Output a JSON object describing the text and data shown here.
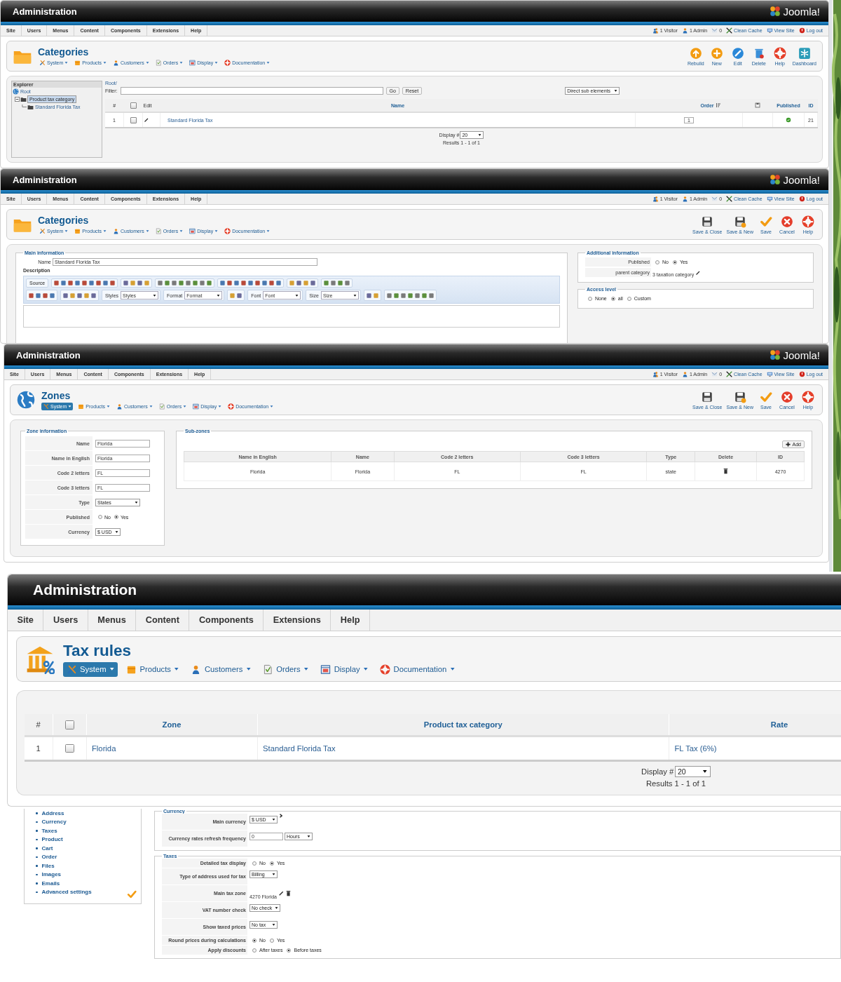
{
  "screens": [
    {
      "kind": "category_list",
      "header": {
        "title": "Administration",
        "logo": "Joomla!"
      },
      "menu": [
        "Site",
        "Users",
        "Menus",
        "Content",
        "Components",
        "Extensions",
        "Help"
      ],
      "status": [
        {
          "kind": "visitor",
          "label": "1 Visitor"
        },
        {
          "kind": "admin",
          "label": "1 Admin"
        },
        {
          "kind": "messages",
          "label": "0"
        },
        {
          "kind": "cache",
          "label": "Clean Cache"
        },
        {
          "kind": "site",
          "label": "View Site"
        },
        {
          "kind": "logout",
          "label": "Log out"
        }
      ],
      "page": {
        "kind": "folder",
        "title": "Categories"
      },
      "submenu": [
        {
          "kind": "system",
          "label": "System",
          "selected": false
        },
        {
          "kind": "products",
          "label": "Products",
          "selected": false
        },
        {
          "kind": "customers",
          "label": "Customers",
          "selected": false
        },
        {
          "kind": "orders",
          "label": "Orders",
          "selected": false
        },
        {
          "kind": "display",
          "label": "Display",
          "selected": false
        },
        {
          "kind": "documentation",
          "label": "Documentation",
          "selected": false
        }
      ],
      "toolbar": [
        {
          "kind": "rebuild",
          "label": "Rebuild"
        },
        {
          "kind": "new",
          "label": "New"
        },
        {
          "kind": "edit",
          "label": "Edit"
        },
        {
          "kind": "delete",
          "label": "Delete"
        },
        {
          "kind": "help",
          "label": "Help"
        },
        {
          "kind": "dashboard",
          "label": "Dashboard"
        }
      ],
      "explorer": {
        "title": "Explorer",
        "tree": [
          {
            "label": "Root",
            "selected": false,
            "children": [
              {
                "label": "Product tax category",
                "selected": true,
                "children": [
                  {
                    "label": "Standard Florida Tax",
                    "selected": false
                  }
                ]
              }
            ]
          }
        ]
      },
      "breadcrumb": "Root/",
      "filter": {
        "label": "Filter:"
      },
      "buttons": [
        "Go",
        "Reset"
      ],
      "view": "Direct sub elements",
      "columns": [
        {
          "kind": "text",
          "label": "#"
        },
        {
          "kind": "checkbox",
          "checked": false
        },
        {
          "kind": "text",
          "label": "Edit"
        },
        {
          "kind": "text",
          "label": "Name"
        },
        {
          "kind": "sort",
          "label": "Order"
        },
        {
          "kind": "icon"
        },
        {
          "kind": "text",
          "label": "Published"
        },
        {
          "kind": "text",
          "label": "ID"
        }
      ],
      "rows": [
        {
          "num": "1",
          "checked": false,
          "name": "Standard Florida Tax",
          "order": "1",
          "published": true,
          "id": "21"
        }
      ],
      "pagination": {
        "label": "Display #",
        "value": "20",
        "results": "Results 1 - 1 of 1"
      }
    },
    {
      "kind": "category_edit",
      "header": {
        "title": "Administration",
        "logo": "Joomla!"
      },
      "menu": [
        "Site",
        "Users",
        "Menus",
        "Content",
        "Components",
        "Extensions",
        "Help"
      ],
      "status": [
        {
          "kind": "visitor",
          "label": "1 Visitor"
        },
        {
          "kind": "admin",
          "label": "1 Admin"
        },
        {
          "kind": "messages",
          "label": "0"
        },
        {
          "kind": "cache",
          "label": "Clean Cache"
        },
        {
          "kind": "site",
          "label": "View Site"
        },
        {
          "kind": "logout",
          "label": "Log out"
        }
      ],
      "page": {
        "kind": "folder",
        "title": "Categories"
      },
      "submenu": [
        {
          "kind": "system",
          "label": "System",
          "selected": false
        },
        {
          "kind": "products",
          "label": "Products",
          "selected": false
        },
        {
          "kind": "customers",
          "label": "Customers",
          "selected": false
        },
        {
          "kind": "orders",
          "label": "Orders",
          "selected": false
        },
        {
          "kind": "display",
          "label": "Display",
          "selected": false
        },
        {
          "kind": "documentation",
          "label": "Documentation",
          "selected": false
        }
      ],
      "toolbar": [
        {
          "kind": "save_close",
          "label": "Save & Close"
        },
        {
          "kind": "save_new",
          "label": "Save & New"
        },
        {
          "kind": "save",
          "label": "Save"
        },
        {
          "kind": "cancel",
          "label": "Cancel"
        },
        {
          "kind": "help",
          "label": "Help"
        }
      ],
      "main": {
        "legend": "Main information",
        "name_label": "Name",
        "name_value": "Standard Florida Tax",
        "description_label": "Description",
        "editor": [
          [
            {
              "kind": "source",
              "label": "Source"
            },
            {
              "kind": "icons"
            },
            {
              "kind": "icons"
            },
            {
              "kind": "icons"
            },
            {
              "kind": "icons"
            },
            {
              "kind": "icons"
            },
            {
              "kind": "icons"
            }
          ],
          [
            {
              "kind": "icons"
            },
            {
              "kind": "icons"
            },
            {
              "kind": "combo",
              "label": "Styles",
              "value": "Styles"
            },
            {
              "kind": "combo",
              "label": "Format",
              "value": "Format"
            },
            {
              "kind": "icons"
            },
            {
              "kind": "combo",
              "label": "Font",
              "value": "Font"
            },
            {
              "kind": "combo",
              "label": "Size",
              "value": "Size"
            },
            {
              "kind": "icons"
            },
            {
              "kind": "icons"
            }
          ]
        ]
      },
      "additional": {
        "legend": "Additional information",
        "fields": [
          {
            "kind": "radio",
            "label": "Published",
            "options": [
              {
                "label": "No",
                "selected": false
              },
              {
                "label": "Yes",
                "selected": true
              }
            ]
          },
          {
            "kind": "link",
            "label": "parent category",
            "value": "3 taxation category"
          }
        ]
      },
      "access": {
        "legend": "Access level",
        "options": [
          {
            "label": "None",
            "selected": false
          },
          {
            "label": "all",
            "selected": true
          },
          {
            "label": "Custom",
            "selected": false
          }
        ]
      }
    },
    {
      "kind": "zone_edit",
      "header": {
        "title": "Administration",
        "logo": "Joomla!"
      },
      "menu": [
        "Site",
        "Users",
        "Menus",
        "Content",
        "Components",
        "Extensions",
        "Help"
      ],
      "status": [
        {
          "kind": "visitor",
          "label": "1 Visitor"
        },
        {
          "kind": "admin",
          "label": "1 Admin"
        },
        {
          "kind": "messages",
          "label": "0"
        },
        {
          "kind": "cache",
          "label": "Clean Cache"
        },
        {
          "kind": "site",
          "label": "View Site"
        },
        {
          "kind": "logout",
          "label": "Log out"
        }
      ],
      "page": {
        "kind": "globe",
        "title": "Zones"
      },
      "submenu": [
        {
          "kind": "system",
          "label": "System",
          "selected": true
        },
        {
          "kind": "products",
          "label": "Products",
          "selected": false
        },
        {
          "kind": "customers",
          "label": "Customers",
          "selected": false
        },
        {
          "kind": "orders",
          "label": "Orders",
          "selected": false
        },
        {
          "kind": "display",
          "label": "Display",
          "selected": false
        },
        {
          "kind": "documentation",
          "label": "Documentation",
          "selected": false
        }
      ],
      "toolbar": [
        {
          "kind": "save_close",
          "label": "Save & Close"
        },
        {
          "kind": "save_new",
          "label": "Save & New"
        },
        {
          "kind": "save",
          "label": "Save"
        },
        {
          "kind": "cancel",
          "label": "Cancel"
        },
        {
          "kind": "help",
          "label": "Help"
        }
      ],
      "zone": {
        "legend": "Zone information",
        "fields": [
          {
            "kind": "input",
            "label": "Name",
            "value": "Florida"
          },
          {
            "kind": "input",
            "label": "Name in English",
            "value": "Florida"
          },
          {
            "kind": "input",
            "label": "Code 2 letters",
            "value": "FL"
          },
          {
            "kind": "input",
            "label": "Code 3 letters",
            "value": "FL"
          },
          {
            "kind": "select",
            "label": "Type",
            "value": "States"
          },
          {
            "kind": "radio",
            "label": "Published",
            "options": [
              {
                "label": "No",
                "selected": false
              },
              {
                "label": "Yes",
                "selected": true
              }
            ]
          },
          {
            "kind": "select",
            "label": "Currency",
            "value": "$ USD"
          }
        ]
      },
      "subzones": {
        "legend": "Sub-zones",
        "add": "Add",
        "columns": [
          "Name in English",
          "Name",
          "Code 2 letters",
          "Code 3 letters",
          "Type",
          "Delete",
          "ID"
        ],
        "rows": [
          {
            "name_en": "Florida",
            "name": "Florida",
            "code2": "FL",
            "code3": "FL",
            "type": "state",
            "id": "4270"
          }
        ]
      }
    },
    {
      "kind": "tax_rules",
      "header": {
        "title": "Administration"
      },
      "menu": [
        "Site",
        "Users",
        "Menus",
        "Content",
        "Components",
        "Extensions",
        "Help"
      ],
      "page": {
        "kind": "tax",
        "title": "Tax rules"
      },
      "submenu": [
        {
          "kind": "system",
          "label": "System",
          "selected": true
        },
        {
          "kind": "products",
          "label": "Products",
          "selected": false
        },
        {
          "kind": "customers",
          "label": "Customers",
          "selected": false
        },
        {
          "kind": "orders",
          "label": "Orders",
          "selected": false
        },
        {
          "kind": "display",
          "label": "Display",
          "selected": false
        },
        {
          "kind": "documentation",
          "label": "Documentation",
          "selected": false
        }
      ],
      "columns": [
        {
          "kind": "text",
          "label": "#"
        },
        {
          "kind": "checkbox",
          "checked": false
        },
        {
          "kind": "text",
          "label": "Zone"
        },
        {
          "kind": "text",
          "label": "Product tax category"
        },
        {
          "kind": "text",
          "label": "Rate"
        }
      ],
      "rows": [
        {
          "num": "1",
          "checked": false,
          "zone": "Florida",
          "category": "Standard Florida Tax",
          "rate": "FL Tax (6%)"
        }
      ],
      "pagination": {
        "label": "Display #",
        "value": "20",
        "results": "Results 1 - 1 of 1"
      }
    },
    {
      "kind": "config",
      "nav": [
        "Address",
        "Currency",
        "Taxes",
        "Product",
        "Cart",
        "Order",
        "Files",
        "Images",
        "Emails",
        "Advanced settings"
      ],
      "sections": [
        {
          "legend": "Currency",
          "fields": [
            {
              "kind": "select",
              "label": "Main currency",
              "value": "$ USD"
            },
            {
              "kind": "input_select",
              "label": "Currency rates refresh frequency",
              "value": "0",
              "unit": "Hours"
            }
          ]
        },
        {
          "legend": "Taxes",
          "fields": [
            {
              "kind": "radio",
              "label": "Detailed tax display",
              "options": [
                {
                  "label": "No",
                  "selected": false
                },
                {
                  "label": "Yes",
                  "selected": true
                }
              ]
            },
            {
              "kind": "select",
              "label": "Type of address used for tax",
              "value": "Billing"
            },
            {
              "kind": "zone",
              "label": "Main tax zone",
              "value": "4270 Florida"
            },
            {
              "kind": "select",
              "label": "VAT number check",
              "value": "No check"
            },
            {
              "kind": "select",
              "label": "Show taxed prices",
              "value": "No tax"
            },
            {
              "kind": "radio",
              "label": "Round prices during calculations",
              "options": [
                {
                  "label": "No",
                  "selected": true
                },
                {
                  "label": "Yes",
                  "selected": false
                }
              ]
            },
            {
              "kind": "radio",
              "label": "Apply discounts",
              "options": [
                {
                  "label": "After taxes",
                  "selected": false
                },
                {
                  "label": "Before taxes",
                  "selected": true
                }
              ]
            }
          ]
        }
      ]
    }
  ]
}
